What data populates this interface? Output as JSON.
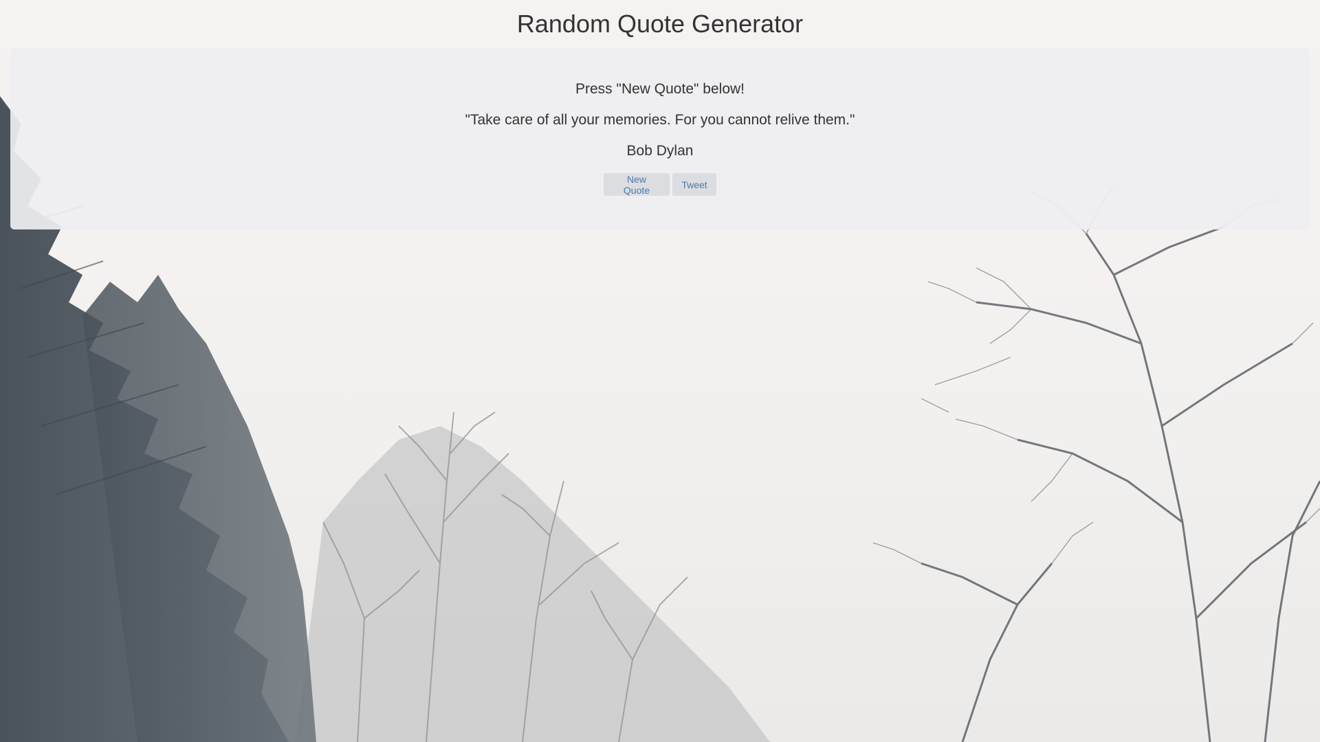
{
  "page": {
    "title": "Random Quote Generator"
  },
  "quote_box": {
    "prompt": "Press \"New Quote\" below!",
    "quote": "\"Take care of all your memories. For you cannot relive them.\"",
    "author": "Bob Dylan"
  },
  "buttons": {
    "new_quote_label": "New Quote",
    "tweet_label": "Tweet"
  },
  "colors": {
    "panel_background": "#eeeef0",
    "button_background": "#dcdde0",
    "button_text": "#4a7ab0",
    "text": "#333333"
  }
}
